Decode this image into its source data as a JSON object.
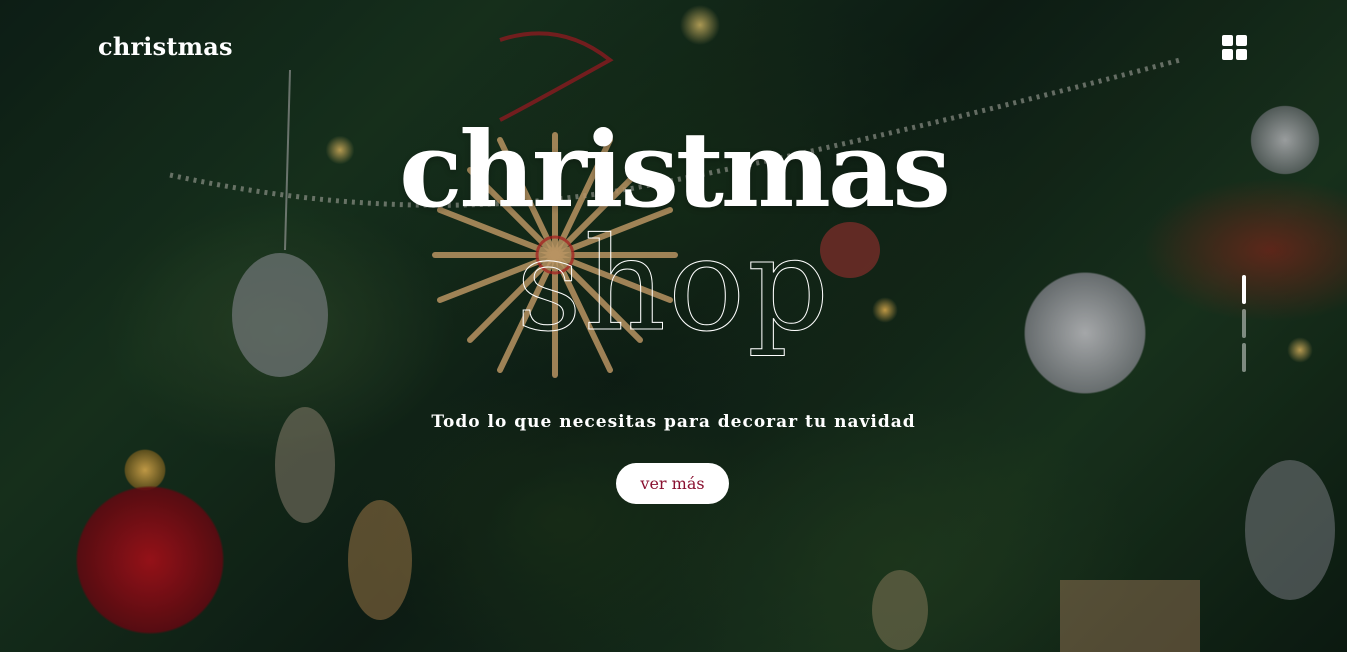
{
  "header": {
    "logo_text": "christmas",
    "menu_icon": "grid-menu-icon"
  },
  "hero": {
    "title": "christmas",
    "subtitle": "shop",
    "tagline": "Todo lo que necesitas para decorar tu navidad",
    "cta_label": "ver más",
    "slides_total": 3,
    "active_slide": 1
  },
  "colors": {
    "text": "#ffffff",
    "cta_text": "#8a1030",
    "cta_background": "#ffffff"
  }
}
